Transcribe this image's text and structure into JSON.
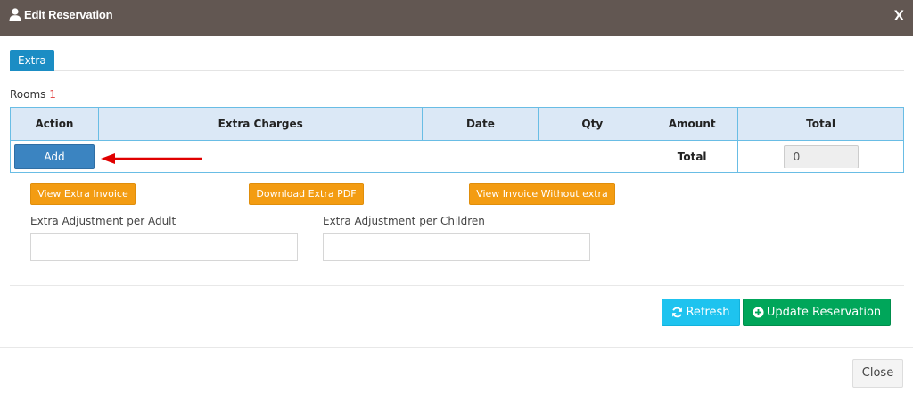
{
  "header": {
    "title": "Edit Reservation",
    "close_label": "X"
  },
  "tabs": [
    {
      "label": "Extra",
      "active": true
    }
  ],
  "rooms": {
    "label": "Rooms",
    "count": "1"
  },
  "table": {
    "columns": [
      "Action",
      "Extra Charges",
      "Date",
      "Qty",
      "Amount",
      "Total"
    ],
    "add_label": "Add",
    "total_label": "Total",
    "total_value": "0"
  },
  "actions": {
    "view_extra_invoice": "View Extra Invoice",
    "download_extra_pdf": "Download Extra PDF",
    "view_invoice_without_extra": "View Invoice Without extra"
  },
  "fields": {
    "adult_label": "Extra Adjustment per Adult",
    "children_label": "Extra Adjustment per Children",
    "adult_value": "",
    "children_value": ""
  },
  "footer": {
    "refresh_label": "Refresh",
    "update_label": "Update Reservation",
    "close_label": "Close"
  },
  "colors": {
    "header_bg": "#625752",
    "tab_blue": "#1b8dc4",
    "add_blue": "#3b84c1",
    "orange": "#f39c12",
    "refresh_cyan": "#1ec3ef",
    "update_green": "#00a65a",
    "arrow_red": "#e00000"
  },
  "icons": [
    "user-icon",
    "refresh-icon",
    "plus-circle-icon",
    "red-arrow-icon"
  ]
}
